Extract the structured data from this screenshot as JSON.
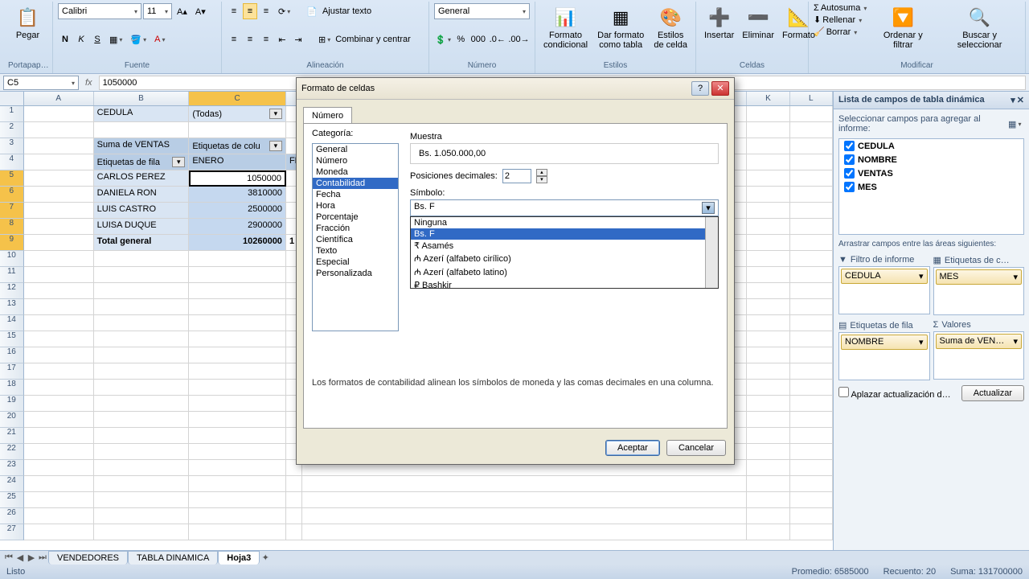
{
  "ribbon": {
    "groups": {
      "clipboard": "Portapap…",
      "font": "Fuente",
      "alignment": "Alineación",
      "number": "Número",
      "styles": "Estilos",
      "cells": "Celdas",
      "editing": "Modificar"
    },
    "paste": "Pegar",
    "font_name": "Calibri",
    "font_size": "11",
    "wrap": "Ajustar texto",
    "merge": "Combinar y centrar",
    "number_format": "General",
    "cond_format": "Formato condicional",
    "format_table": "Dar formato como tabla",
    "cell_styles": "Estilos de celda",
    "insert": "Insertar",
    "delete": "Eliminar",
    "format": "Formato",
    "autosum": "Autosuma",
    "fill": "Rellenar",
    "clear": "Borrar",
    "sort": "Ordenar y filtrar",
    "find": "Buscar y seleccionar"
  },
  "namebox": "C5",
  "formula": "1050000",
  "columns": [
    "A",
    "B",
    "C",
    "D",
    "K",
    "L"
  ],
  "col_widths": {
    "A": 88,
    "B": 120,
    "C": 122,
    "D": 14
  },
  "rows_visible": 27,
  "pivot": {
    "r1": {
      "b": "CEDULA",
      "c": "(Todas)"
    },
    "r3": {
      "a": "Suma de VENTAS",
      "b": "Etiquetas de colu"
    },
    "r4": {
      "a": "Etiquetas de fila",
      "b": "ENERO",
      "c": "FE"
    },
    "data": [
      {
        "name": "CARLOS PEREZ",
        "v": "1050000"
      },
      {
        "name": "DANIELA RON",
        "v": "3810000"
      },
      {
        "name": "LUIS CASTRO",
        "v": "2500000"
      },
      {
        "name": "LUISA DUQUE",
        "v": "2900000"
      }
    ],
    "total_label": "Total general",
    "total_value": "10260000",
    "total_next": "1"
  },
  "sheets": [
    "VENDEDORES",
    "TABLA DINAMICA",
    "Hoja3"
  ],
  "active_sheet": 2,
  "status": {
    "ready": "Listo",
    "avg": "Promedio: 6585000",
    "count": "Recuento: 20",
    "sum": "Suma: 131700000"
  },
  "fieldlist": {
    "title": "Lista de campos de tabla dinámica",
    "subtitle": "Seleccionar campos para agregar al informe:",
    "fields": [
      "CEDULA",
      "NOMBRE",
      "VENTAS",
      "MES"
    ],
    "areas_label": "Arrastrar campos entre las áreas siguientes:",
    "filter": "Filtro de informe",
    "cols": "Etiquetas de c…",
    "rows": "Etiquetas de fila",
    "values": "Valores",
    "filter_item": "CEDULA",
    "cols_item": "MES",
    "rows_item": "NOMBRE",
    "values_item": "Suma de VEN…",
    "defer": "Aplazar actualización d…",
    "update": "Actualizar"
  },
  "dialog": {
    "title": "Formato de celdas",
    "tab": "Número",
    "cat_label": "Categoría:",
    "categories": [
      "General",
      "Número",
      "Moneda",
      "Contabilidad",
      "Fecha",
      "Hora",
      "Porcentaje",
      "Fracción",
      "Científica",
      "Texto",
      "Especial",
      "Personalizada"
    ],
    "cat_selected": 3,
    "sample_label": "Muestra",
    "sample_value": "Bs.   1.050.000,00",
    "decimals_label": "Posiciones decimales:",
    "decimals": "2",
    "symbol_label": "Símbolo:",
    "symbol_value": "Bs. F",
    "symbol_options": [
      "Ninguna",
      "Bs. F",
      "₹ Asamés",
      "₼ Azerí (alfabeto cirílico)",
      "₼ Azerí (alfabeto latino)",
      "₽ Bashkir"
    ],
    "symbol_selected": 1,
    "description": "Los formatos de contabilidad alinean los símbolos de moneda y las comas decimales en una columna.",
    "ok": "Aceptar",
    "cancel": "Cancelar"
  }
}
